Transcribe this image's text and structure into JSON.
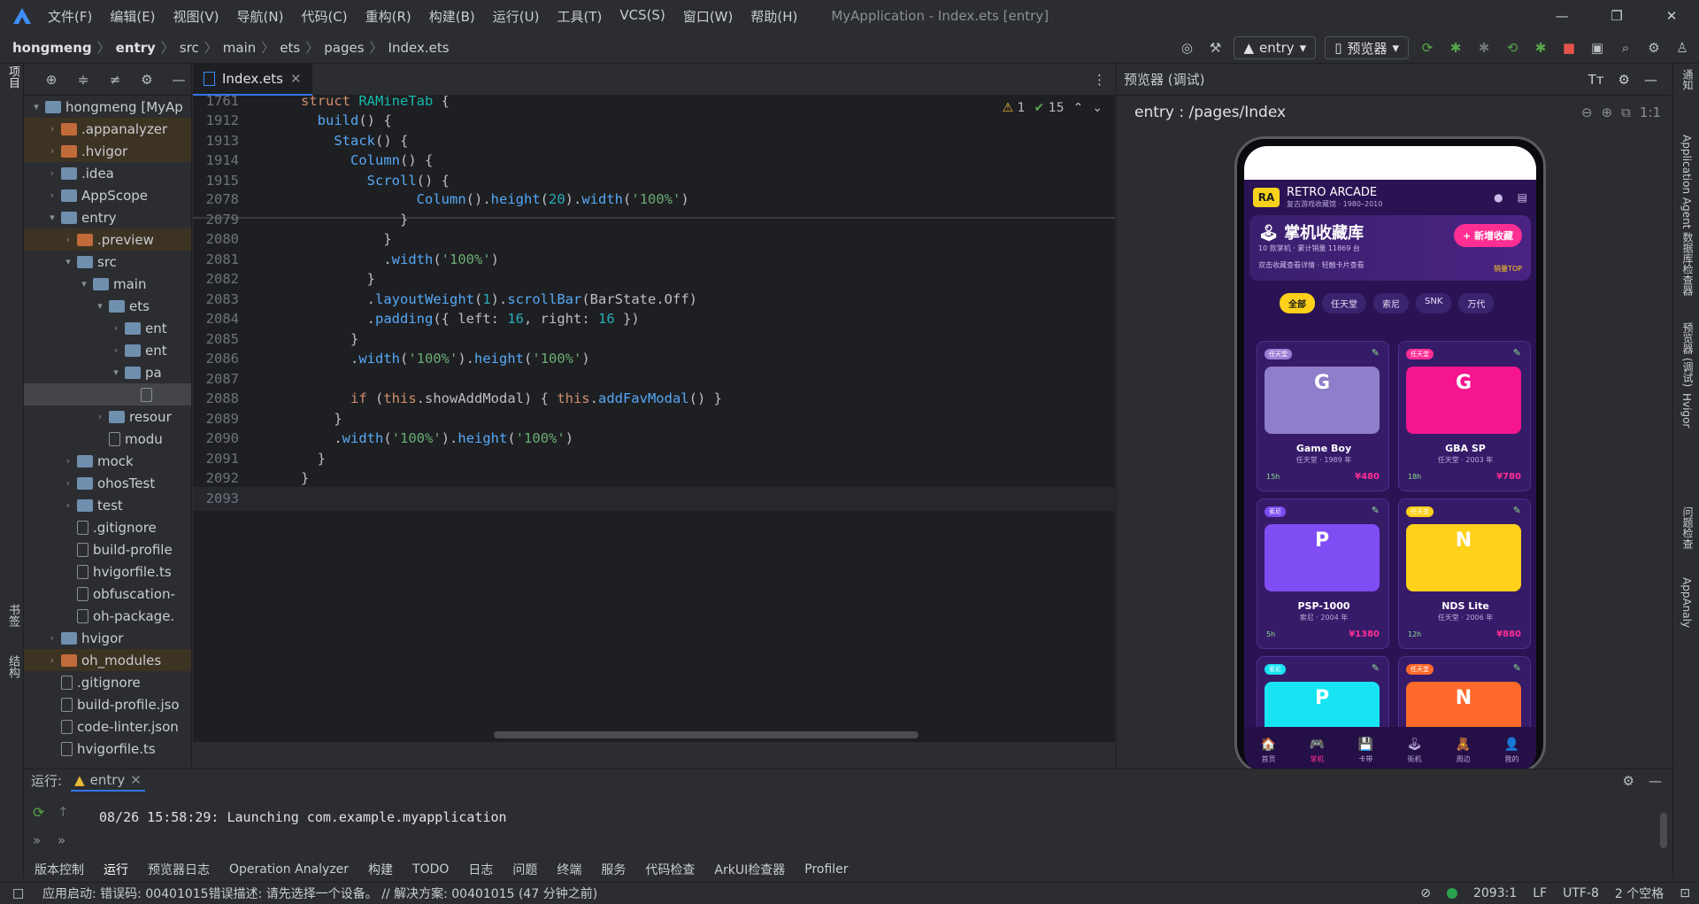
{
  "window": {
    "menu": [
      "文件(F)",
      "编辑(E)",
      "视图(V)",
      "导航(N)",
      "代码(C)",
      "重构(R)",
      "构建(B)",
      "运行(U)",
      "工具(T)",
      "VCS(S)",
      "窗口(W)",
      "帮助(H)"
    ],
    "title": "MyApplication - Index.ets [entry]"
  },
  "breadcrumb": [
    "hongmeng",
    "entry",
    "src",
    "main",
    "ets",
    "pages",
    "Index.ets"
  ],
  "toolbar": {
    "run_config": "entry",
    "device": "预览器"
  },
  "left_strip": {
    "project": "项目",
    "bookmarks": "书签",
    "structure": "结构"
  },
  "project_tree": [
    {
      "indent": 0,
      "arrow": "▾",
      "icon": "folder",
      "label": "hongmeng [MyAp",
      "cls": ""
    },
    {
      "indent": 1,
      "arrow": "›",
      "icon": "folder orange",
      "label": ".appanalyzer",
      "cls": "hl"
    },
    {
      "indent": 1,
      "arrow": "›",
      "icon": "folder orange",
      "label": ".hvigor",
      "cls": "hl"
    },
    {
      "indent": 1,
      "arrow": "›",
      "icon": "folder",
      "label": ".idea",
      "cls": ""
    },
    {
      "indent": 1,
      "arrow": "›",
      "icon": "folder",
      "label": "AppScope",
      "cls": ""
    },
    {
      "indent": 1,
      "arrow": "▾",
      "icon": "folder",
      "label": "entry",
      "cls": ""
    },
    {
      "indent": 2,
      "arrow": "›",
      "icon": "folder orange",
      "label": ".preview",
      "cls": "hl"
    },
    {
      "indent": 2,
      "arrow": "▾",
      "icon": "folder",
      "label": "src",
      "cls": ""
    },
    {
      "indent": 3,
      "arrow": "▾",
      "icon": "folder",
      "label": "main",
      "cls": ""
    },
    {
      "indent": 4,
      "arrow": "▾",
      "icon": "folder",
      "label": "ets",
      "cls": ""
    },
    {
      "indent": 5,
      "arrow": "›",
      "icon": "folder",
      "label": "ent",
      "cls": ""
    },
    {
      "indent": 5,
      "arrow": "›",
      "icon": "folder",
      "label": "ent",
      "cls": ""
    },
    {
      "indent": 5,
      "arrow": "▾",
      "icon": "folder",
      "label": "pa",
      "cls": ""
    },
    {
      "indent": 6,
      "arrow": "",
      "icon": "filei",
      "label": "",
      "cls": "sel"
    },
    {
      "indent": 4,
      "arrow": "›",
      "icon": "folder",
      "label": "resour",
      "cls": ""
    },
    {
      "indent": 4,
      "arrow": "",
      "icon": "filei",
      "label": "modu",
      "cls": ""
    },
    {
      "indent": 2,
      "arrow": "›",
      "icon": "folder",
      "label": "mock",
      "cls": ""
    },
    {
      "indent": 2,
      "arrow": "›",
      "icon": "folder",
      "label": "ohosTest",
      "cls": ""
    },
    {
      "indent": 2,
      "arrow": "›",
      "icon": "folder",
      "label": "test",
      "cls": ""
    },
    {
      "indent": 2,
      "arrow": "",
      "icon": "filei",
      "label": ".gitignore",
      "cls": ""
    },
    {
      "indent": 2,
      "arrow": "",
      "icon": "filei",
      "label": "build-profile",
      "cls": ""
    },
    {
      "indent": 2,
      "arrow": "",
      "icon": "filei",
      "label": "hvigorfile.ts",
      "cls": ""
    },
    {
      "indent": 2,
      "arrow": "",
      "icon": "filei",
      "label": "obfuscation-",
      "cls": ""
    },
    {
      "indent": 2,
      "arrow": "",
      "icon": "filei",
      "label": "oh-package.",
      "cls": ""
    },
    {
      "indent": 1,
      "arrow": "›",
      "icon": "folder",
      "label": "hvigor",
      "cls": ""
    },
    {
      "indent": 1,
      "arrow": "›",
      "icon": "folder orange",
      "label": "oh_modules",
      "cls": "hl"
    },
    {
      "indent": 1,
      "arrow": "",
      "icon": "filei",
      "label": ".gitignore",
      "cls": ""
    },
    {
      "indent": 1,
      "arrow": "",
      "icon": "filei",
      "label": "build-profile.jso",
      "cls": ""
    },
    {
      "indent": 1,
      "arrow": "",
      "icon": "filei",
      "label": "code-linter.json",
      "cls": ""
    },
    {
      "indent": 1,
      "arrow": "",
      "icon": "filei",
      "label": "hvigorfile.ts",
      "cls": ""
    }
  ],
  "editor": {
    "tab": "Index.ets",
    "warnings": "1",
    "checks": "15",
    "lines": [
      {
        "n": "1761",
        "html": "<span class='kw'>struct</span> <span class='ty'>RAMineTab</span> {"
      },
      {
        "n": "1912",
        "html": "  <span class='fn'>build</span>() {"
      },
      {
        "n": "1913",
        "html": "    <span class='fn'>Stack</span>() {"
      },
      {
        "n": "1914",
        "html": "      <span class='fn'>Column</span>() {"
      },
      {
        "n": "1915",
        "html": "        <span class='fn'>Scroll</span>() {"
      },
      {
        "n": "2078",
        "html": "              <span class='fn'>Column</span>().<span class='fn'>height</span>(<span class='num'>20</span>).<span class='fn'>width</span>(<span class='str'>'100%'</span>)"
      },
      {
        "n": "2079",
        "html": "            }"
      },
      {
        "n": "2080",
        "html": "          }"
      },
      {
        "n": "2081",
        "html": "          .<span class='fn'>width</span>(<span class='str'>'100%'</span>)"
      },
      {
        "n": "2082",
        "html": "        }"
      },
      {
        "n": "2083",
        "html": "        .<span class='fn'>layoutWeight</span>(<span class='num'>1</span>).<span class='fn'>scrollBar</span>(BarState.Off)"
      },
      {
        "n": "2084",
        "html": "        .<span class='fn'>padding</span>({ left: <span class='num'>16</span>, right: <span class='num'>16</span> })"
      },
      {
        "n": "2085",
        "html": "      }"
      },
      {
        "n": "2086",
        "html": "      .<span class='fn'>width</span>(<span class='str'>'100%'</span>).<span class='fn'>height</span>(<span class='str'>'100%'</span>)"
      },
      {
        "n": "2087",
        "html": ""
      },
      {
        "n": "2088",
        "html": "      <span class='kw'>if</span> (<span class='kw'>this</span>.showAddModal) { <span class='kw'>this</span>.<span class='fn'>addFavModal</span>() }"
      },
      {
        "n": "2089",
        "html": "    }"
      },
      {
        "n": "2090",
        "html": "    .<span class='fn'>width</span>(<span class='str'>'100%'</span>).<span class='fn'>height</span>(<span class='str'>'100%'</span>)"
      },
      {
        "n": "2091",
        "html": "  }"
      },
      {
        "n": "2092",
        "html": "}"
      },
      {
        "n": "2093",
        "html": ""
      }
    ]
  },
  "preview": {
    "header": "预览器 (调试)",
    "path": "entry : /pages/Index",
    "app": {
      "logo": "RA",
      "title": "RETRO ARCADE",
      "subtitle": "复古游戏收藏馆 · 1980–2010",
      "hero_title": "🕹 掌机收藏库",
      "hero_sub": "10 款掌机 · 累计销量 11869 台",
      "hero_note": "双击收藏查看详情 · 轻触卡片查看",
      "hero_top": "销量TOP",
      "add_button": "+ 新增收藏",
      "filters": [
        "全部",
        "任天堂",
        "索尼",
        "SNK",
        "万代"
      ],
      "cards": [
        {
          "badge": "任天堂",
          "badge_color": "#9b7fd6",
          "letter": "G",
          "img_color": "#8e7ecb",
          "name": "Game Boy",
          "meta": "任天堂 · 1989 年",
          "hours": "15h",
          "price": "¥480"
        },
        {
          "badge": "任天堂",
          "badge_color": "#ff2e93",
          "letter": "G",
          "img_color": "#f5158f",
          "name": "GBA SP",
          "meta": "任天堂 · 2003 年",
          "hours": "18h",
          "price": "¥780"
        },
        {
          "badge": "索尼",
          "badge_color": "#7b4cf0",
          "letter": "P",
          "img_color": "#7f4df3",
          "name": "PSP-1000",
          "meta": "索尼 · 2004 年",
          "hours": "5h",
          "price": "¥1380"
        },
        {
          "badge": "任天堂",
          "badge_color": "#ffd11a",
          "letter": "N",
          "img_color": "#ffd11a",
          "name": "NDS Lite",
          "meta": "任天堂 · 2006 年",
          "hours": "12h",
          "price": "¥880"
        },
        {
          "badge": "索尼",
          "badge_color": "#16e3f0",
          "letter": "P",
          "img_color": "#17e4f2",
          "name": "",
          "meta": "",
          "hours": "",
          "price": ""
        },
        {
          "badge": "任天堂",
          "badge_color": "#ff6a2b",
          "letter": "N",
          "img_color": "#ff6a2b",
          "name": "",
          "meta": "",
          "hours": "",
          "price": ""
        }
      ],
      "nav": [
        {
          "icon": "🏠",
          "label": "首页",
          "on": false
        },
        {
          "icon": "🎮",
          "label": "掌机",
          "on": true
        },
        {
          "icon": "💾",
          "label": "卡带",
          "on": false
        },
        {
          "icon": "🕹",
          "label": "街机",
          "on": false
        },
        {
          "icon": "🧸",
          "label": "周边",
          "on": false
        },
        {
          "icon": "👤",
          "label": "我的",
          "on": false
        }
      ]
    }
  },
  "right_strip": [
    "通知",
    "Application Agent",
    "数据库检查器",
    "预览器 (调试)",
    "Hvigor",
    "问题检查",
    "AppAnaly"
  ],
  "run": {
    "label": "运行:",
    "config": "entry",
    "output": "08/26 15:58:29: Launching com.example.myapplication"
  },
  "tool_tabs": [
    "版本控制",
    "运行",
    "预览器日志",
    "Operation Analyzer",
    "构建",
    "TODO",
    "日志",
    "问题",
    "终端",
    "服务",
    "代码检查",
    "ArkUI检查器",
    "Profiler"
  ],
  "status": {
    "message": "应用启动: 错误码: 00401015错误描述: 请先选择一个设备。 // 解决方案: 00401015 (47 分钟之前)",
    "position": "2093:1",
    "line_sep": "LF",
    "encoding": "UTF-8",
    "indent": "2 个空格"
  }
}
